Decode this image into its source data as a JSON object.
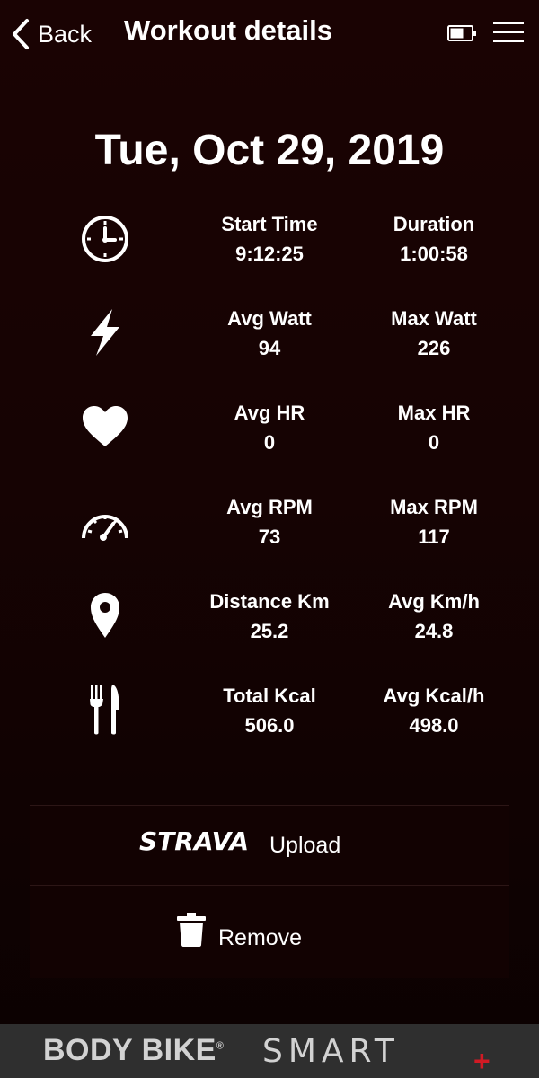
{
  "header": {
    "back_label": "Back",
    "title": "Workout details"
  },
  "date": "Tue, Oct 29, 2019",
  "stats": [
    {
      "icon": "clock-icon",
      "left": {
        "label": "Start Time",
        "value": "9:12:25"
      },
      "right": {
        "label": "Duration",
        "value": "1:00:58"
      }
    },
    {
      "icon": "lightning-icon",
      "left": {
        "label": "Avg Watt",
        "value": "94"
      },
      "right": {
        "label": "Max Watt",
        "value": "226"
      }
    },
    {
      "icon": "heart-icon",
      "left": {
        "label": "Avg HR",
        "value": "0"
      },
      "right": {
        "label": "Max HR",
        "value": "0"
      }
    },
    {
      "icon": "speedometer-icon",
      "left": {
        "label": "Avg RPM",
        "value": "73"
      },
      "right": {
        "label": "Max RPM",
        "value": "117"
      }
    },
    {
      "icon": "location-pin-icon",
      "left": {
        "label": "Distance Km",
        "value": "25.2"
      },
      "right": {
        "label": "Avg Km/h",
        "value": "24.8"
      }
    },
    {
      "icon": "fork-knife-icon",
      "left": {
        "label": "Total Kcal",
        "value": "506.0"
      },
      "right": {
        "label": "Avg Kcal/h",
        "value": "498.0"
      }
    }
  ],
  "actions": {
    "strava_logo": "STRAVA",
    "upload_label": "Upload",
    "remove_label": "Remove"
  },
  "footer": {
    "brand_body": "BODY BIKE",
    "brand_reg": "®",
    "brand_smart": "SMART",
    "brand_plus": "+"
  },
  "colors": {
    "background": "#160303",
    "footer": "#2f2f2f",
    "accent_red": "#d11a24"
  }
}
